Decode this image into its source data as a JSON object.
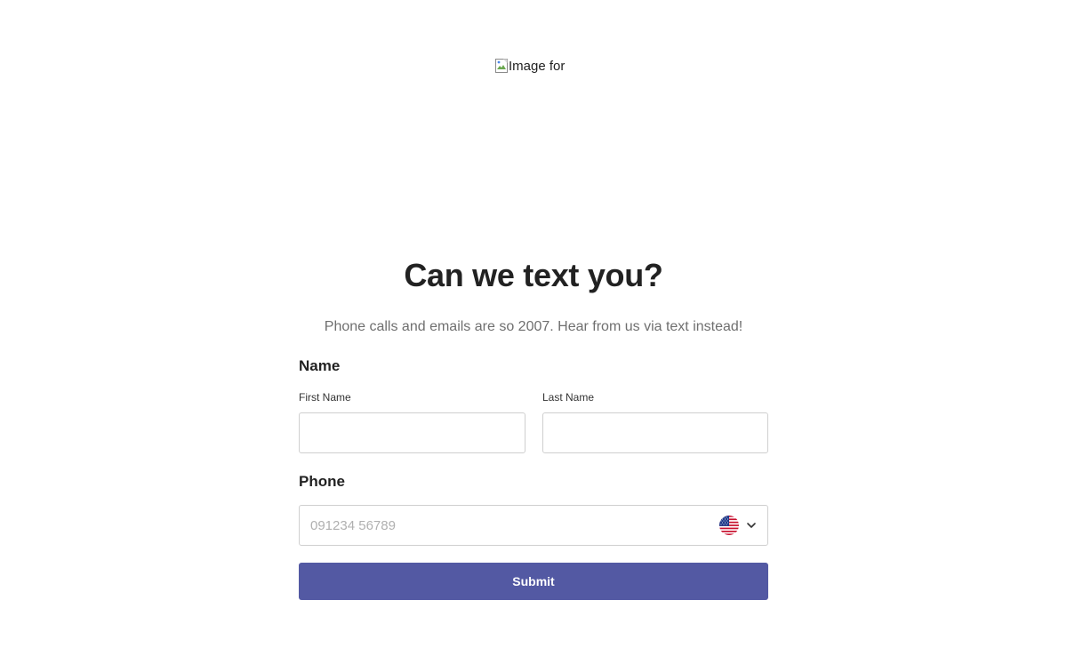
{
  "hero": {
    "image_alt": "Image for"
  },
  "header": {
    "title": "Can we text you?",
    "subtitle": "Phone calls and emails are so 2007. Hear from us via text instead!"
  },
  "form": {
    "name_section_label": "Name",
    "first_name_label": "First Name",
    "first_name_value": "",
    "last_name_label": "Last Name",
    "last_name_value": "",
    "phone_section_label": "Phone",
    "phone_placeholder": "091234 56789",
    "phone_value": "",
    "country": {
      "selected": "United States",
      "icon": "us-flag-icon"
    },
    "submit_label": "Submit"
  },
  "colors": {
    "accent": "#5359a3",
    "border": "#cfcfcf",
    "title": "#222222",
    "subtitle": "#6f6f6f"
  }
}
